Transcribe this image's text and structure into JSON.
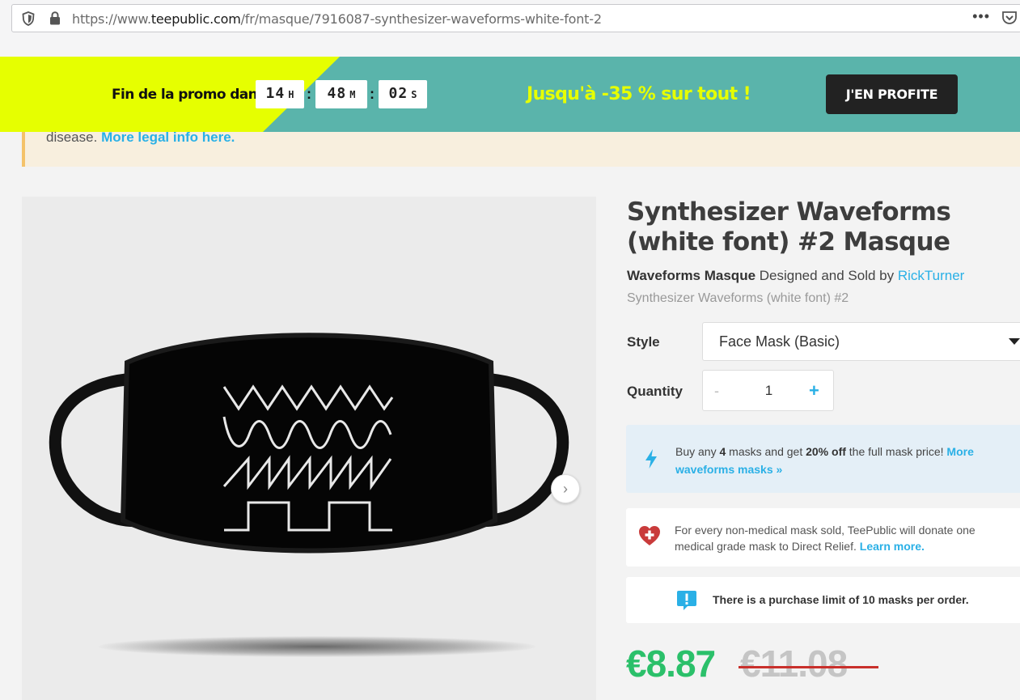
{
  "browser": {
    "url_prefix": "https://www.",
    "url_host": "teepublic.com",
    "url_path": "/fr/masque/7916087-synthesizer-waveforms-white-font-2",
    "menu_dots": "•••"
  },
  "promo": {
    "countdown_label": "Fin de la promo dans",
    "hours": "14",
    "hours_unit": "H",
    "minutes": "48",
    "minutes_unit": "M",
    "seconds": "02",
    "seconds_unit": "S",
    "separator": ":",
    "deal_text": "Jusqu'à -35 % sur tout !",
    "cta_label": "J'EN PROFITE"
  },
  "notice": {
    "text": "disease.",
    "link": "More legal info here."
  },
  "gallery": {
    "next_arrow": "›"
  },
  "product": {
    "title": "Synthesizer Waveforms (white font) #2 Masque",
    "design_name": "Waveforms Masque",
    "designed_by_text": "Designed and Sold by",
    "designer": "RickTurner",
    "subtitle": "Synthesizer Waveforms (white font) #2",
    "style_label": "Style",
    "style_value": "Face Mask (Basic)",
    "quantity_label": "Quantity",
    "quantity_minus": "-",
    "quantity_value": "1",
    "quantity_plus": "+"
  },
  "offers": {
    "bundle_pre": "Buy any ",
    "bundle_count": "4",
    "bundle_mid": " masks and get ",
    "bundle_discount": "20% off",
    "bundle_post": " the full mask price! ",
    "bundle_link": "More waveforms masks »",
    "donate_text": "For every non-medical mask sold, TeePublic will donate one medical grade mask to Direct Relief.",
    "donate_link": "Learn more.",
    "limit_text": "There is a purchase limit of 10 masks per order."
  },
  "pricing": {
    "price": "€8.87",
    "old_price": "€11.08"
  },
  "colors": {
    "promo_teal": "#5ab4ab",
    "promo_yellow": "#e6ff00",
    "link_blue": "#2ab0e6",
    "price_green": "#2bc06a"
  }
}
